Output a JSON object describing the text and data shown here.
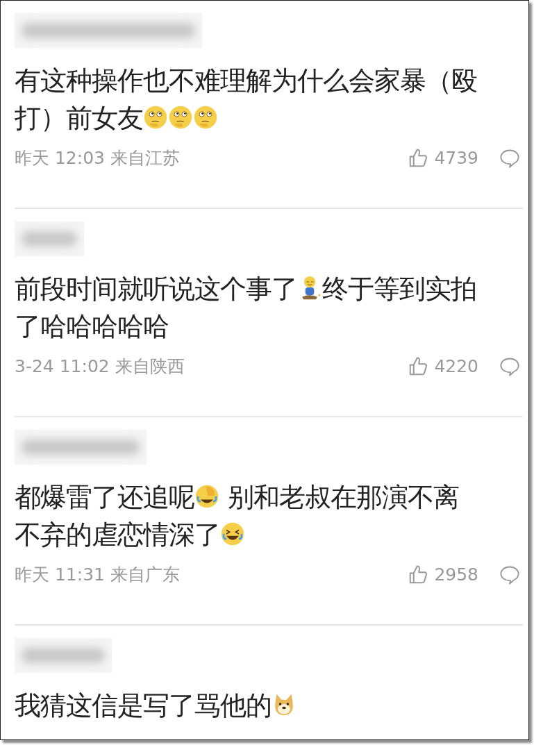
{
  "comments": [
    {
      "content": [
        {
          "kind": "text",
          "text": "有这种操作也不难理解为什么会家暴（殴"
        },
        {
          "kind": "text",
          "text": "打）前女友"
        },
        {
          "kind": "thinking_emoji"
        },
        {
          "kind": "thinking_emoji"
        },
        {
          "kind": "thinking_emoji"
        }
      ],
      "time": "昨天 12:03 来自江苏",
      "likes": "4739"
    },
    {
      "content": [
        {
          "kind": "text",
          "text": "前段时间就听说这个事了"
        },
        {
          "kind": "sitting_emoji"
        },
        {
          "kind": "text",
          "text": "终于等到实拍"
        },
        {
          "kind": "text",
          "text": "了哈哈哈哈哈"
        }
      ],
      "time": "3-24 11:02 来自陕西",
      "likes": "4220"
    },
    {
      "content": [
        {
          "kind": "text",
          "text": "都爆雷了还追呢"
        },
        {
          "kind": "facepalm_emoji"
        },
        {
          "kind": "text",
          "text": "别和老叔在那演不离"
        },
        {
          "kind": "text",
          "text": "不弃的虐恋情深了"
        },
        {
          "kind": "laugh_emoji"
        }
      ],
      "time": "昨天 11:31 来自广东",
      "likes": "2958"
    },
    {
      "content": [
        {
          "kind": "text",
          "text": "我猜这信是写了骂他的"
        },
        {
          "kind": "doge_emoji"
        }
      ]
    }
  ]
}
